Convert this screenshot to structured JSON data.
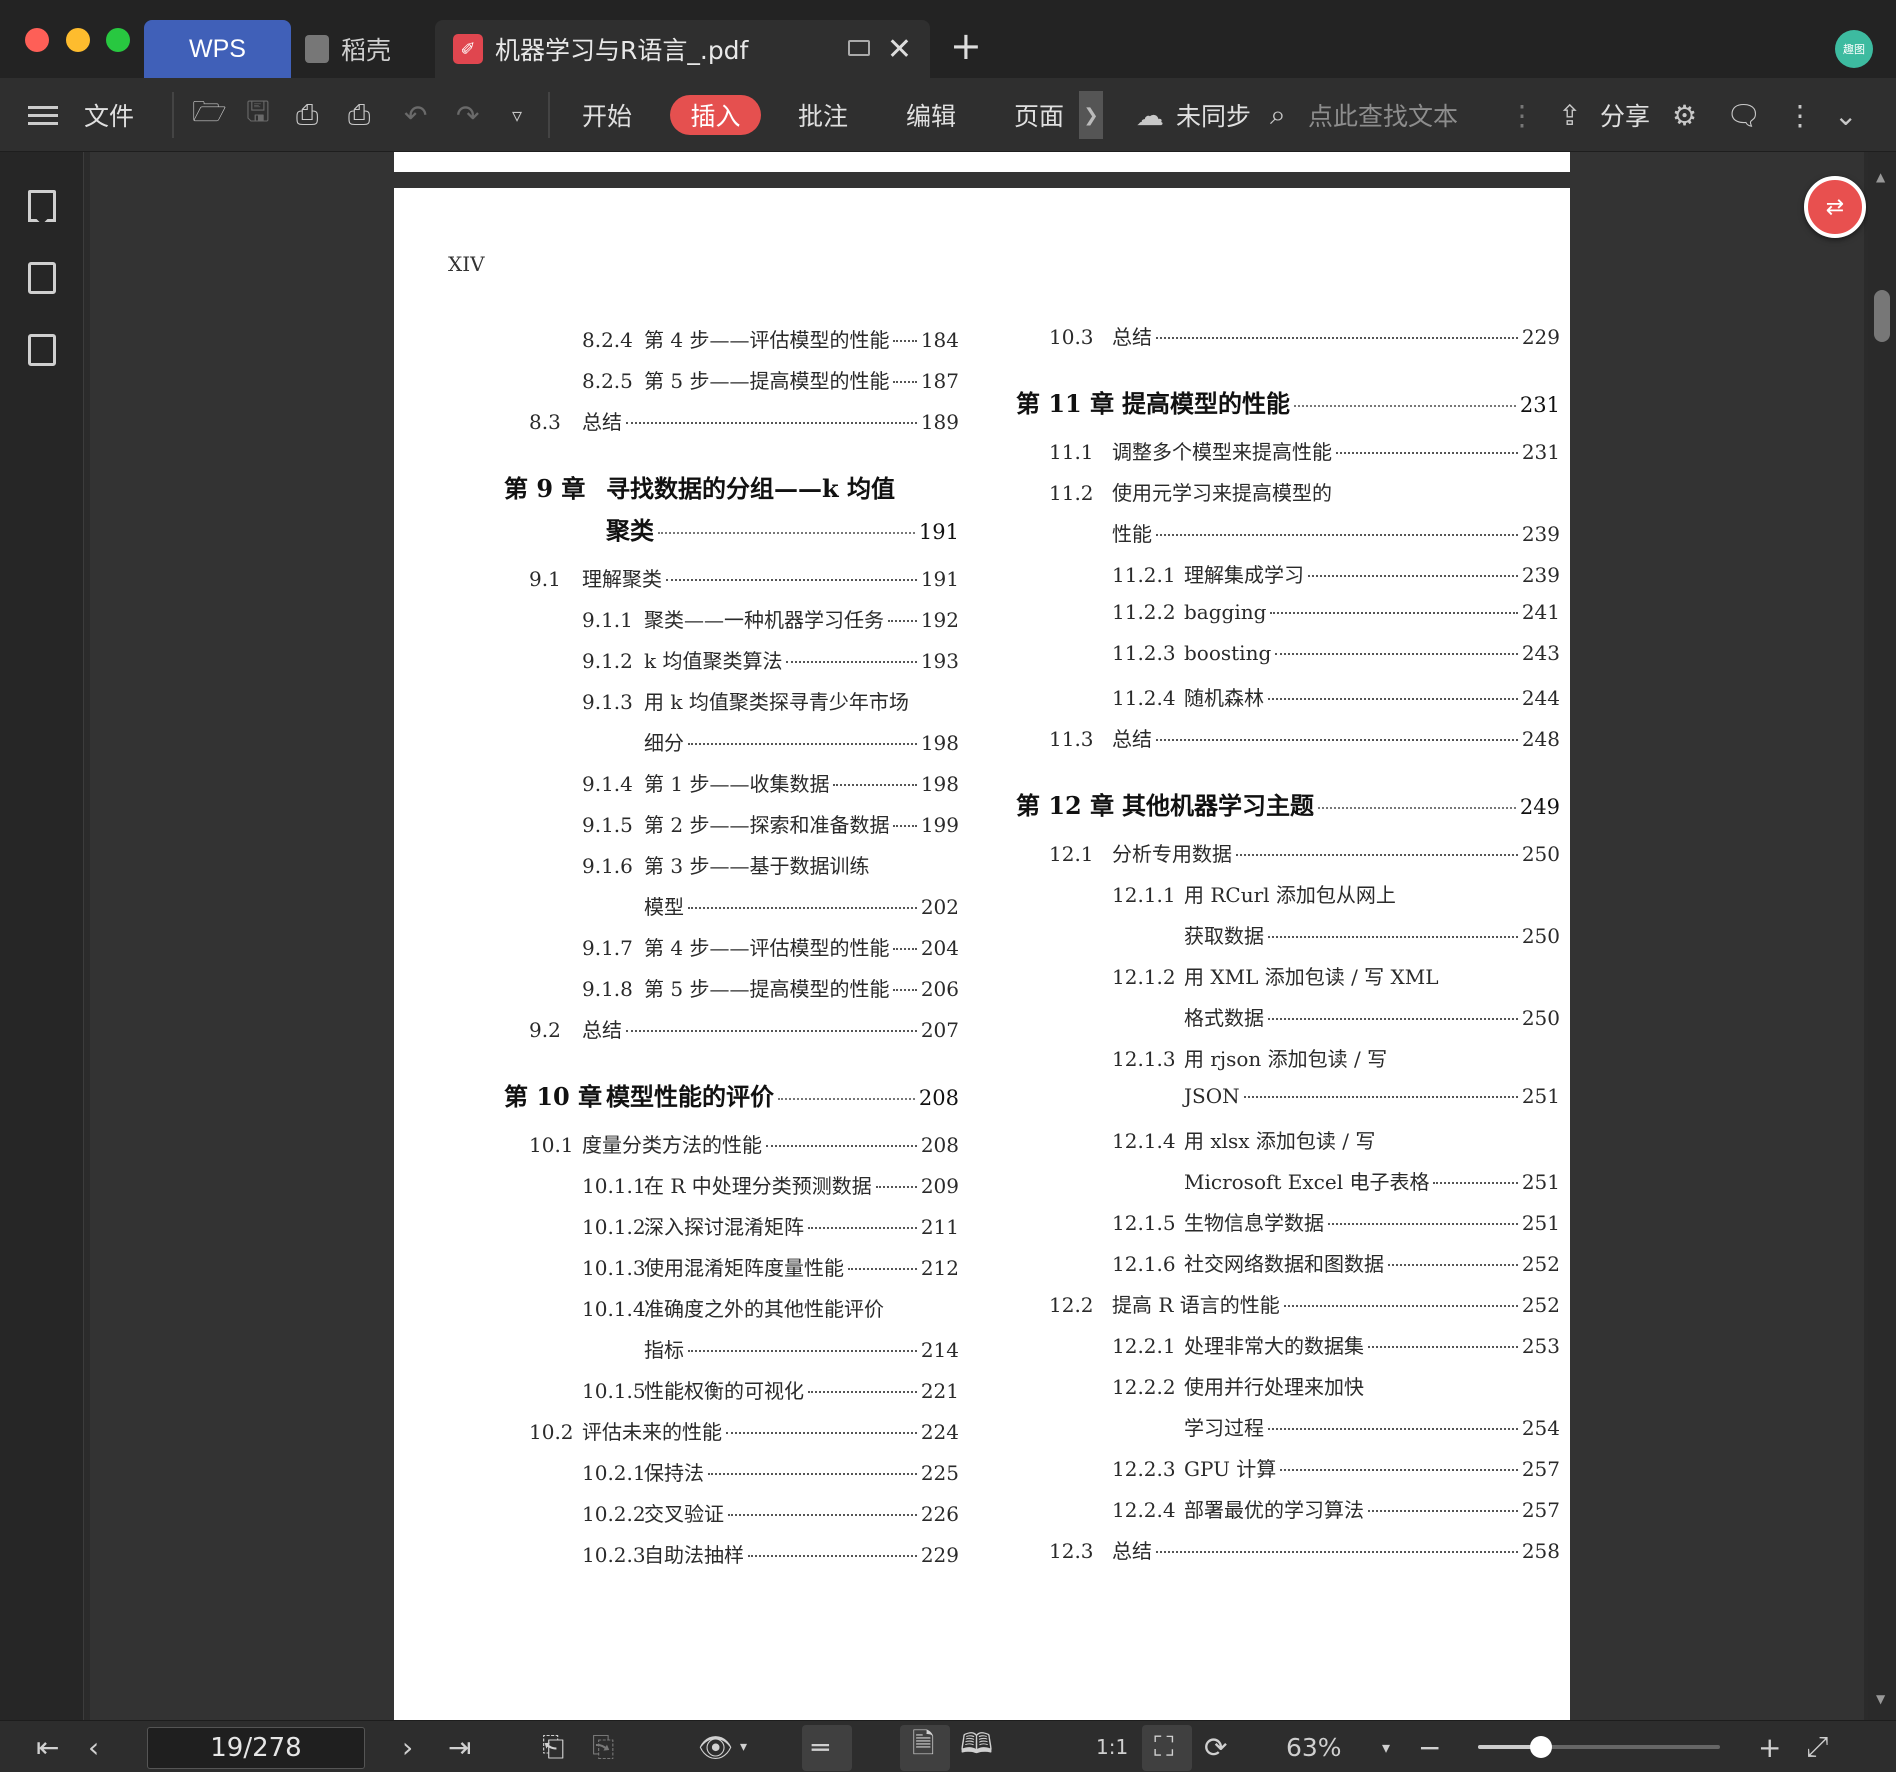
{
  "window": {
    "tabs": [
      {
        "label": "WPS"
      },
      {
        "label": "稻壳"
      },
      {
        "label": "机器学习与R语言_.pdf"
      }
    ],
    "avatar_text": "趣图"
  },
  "toolbar": {
    "file_label": "文件",
    "menu_tabs": [
      "开始",
      "插入",
      "批注",
      "编辑",
      "页面"
    ],
    "active_tab": "插入",
    "sync_label": "未同步",
    "search_placeholder": "点此查找文本",
    "share_label": "分享"
  },
  "document": {
    "page_header": "XIV",
    "left_column": [
      {
        "level": 3,
        "num": "8.2.4",
        "title": "第 4 步——评估模型的性能",
        "page": "184"
      },
      {
        "level": 3,
        "num": "8.2.5",
        "title": "第 5 步——提高模型的性能",
        "page": "187"
      },
      {
        "level": 2,
        "num": "8.3",
        "title": "总结",
        "page": "189"
      },
      {
        "level": 1,
        "num": "第 9 章",
        "title": "寻找数据的分组——k 均值",
        "page": ""
      },
      {
        "level": 1,
        "num": "",
        "title": "聚类",
        "page": "191"
      },
      {
        "level": 2,
        "num": "9.1",
        "title": "理解聚类",
        "page": "191"
      },
      {
        "level": 3,
        "num": "9.1.1",
        "title": "聚类——一种机器学习任务",
        "page": "192"
      },
      {
        "level": 3,
        "num": "9.1.2",
        "title": "k 均值聚类算法",
        "page": "193"
      },
      {
        "level": 3,
        "num": "9.1.3",
        "title": "用 k 均值聚类探寻青少年市场",
        "page": ""
      },
      {
        "level": 3,
        "num": "",
        "title": "细分",
        "page": "198"
      },
      {
        "level": 3,
        "num": "9.1.4",
        "title": "第 1 步——收集数据",
        "page": "198"
      },
      {
        "level": 3,
        "num": "9.1.5",
        "title": "第 2 步——探索和准备数据",
        "page": "199"
      },
      {
        "level": 3,
        "num": "9.1.6",
        "title": "第 3 步——基于数据训练",
        "page": ""
      },
      {
        "level": 3,
        "num": "",
        "title": "模型",
        "page": "202"
      },
      {
        "level": 3,
        "num": "9.1.7",
        "title": "第 4 步——评估模型的性能",
        "page": "204"
      },
      {
        "level": 3,
        "num": "9.1.8",
        "title": "第 5 步——提高模型的性能",
        "page": "206"
      },
      {
        "level": 2,
        "num": "9.2",
        "title": "总结",
        "page": "207"
      },
      {
        "level": 1,
        "num": "第 10 章",
        "title": "模型性能的评价",
        "page": "208"
      },
      {
        "level": 2,
        "num": "10.1",
        "title": "度量分类方法的性能",
        "page": "208"
      },
      {
        "level": 3,
        "num": "10.1.1",
        "title": "在 R 中处理分类预测数据",
        "page": "209"
      },
      {
        "level": 3,
        "num": "10.1.2",
        "title": "深入探讨混淆矩阵",
        "page": "211"
      },
      {
        "level": 3,
        "num": "10.1.3",
        "title": "使用混淆矩阵度量性能",
        "page": "212"
      },
      {
        "level": 3,
        "num": "10.1.4",
        "title": "准确度之外的其他性能评价",
        "page": ""
      },
      {
        "level": 3,
        "num": "",
        "title": "指标",
        "page": "214"
      },
      {
        "level": 3,
        "num": "10.1.5",
        "title": "性能权衡的可视化",
        "page": "221"
      },
      {
        "level": 2,
        "num": "10.2",
        "title": "评估未来的性能",
        "page": "224"
      },
      {
        "level": 3,
        "num": "10.2.1",
        "title": "保持法",
        "page": "225"
      },
      {
        "level": 3,
        "num": "10.2.2",
        "title": "交叉验证",
        "page": "226"
      },
      {
        "level": 3,
        "num": "10.2.3",
        "title": "自助法抽样",
        "page": "229"
      }
    ],
    "right_column": [
      {
        "level": 2,
        "num": "10.3",
        "title": "总结",
        "page": "229"
      },
      {
        "level": 1,
        "num": "第 11 章",
        "title": "提高模型的性能",
        "page": "231"
      },
      {
        "level": 2,
        "num": "11.1",
        "title": "调整多个模型来提高性能",
        "page": "231"
      },
      {
        "level": 2,
        "num": "11.2",
        "title": "使用元学习来提高模型的",
        "page": ""
      },
      {
        "level": 2,
        "num": "",
        "title": "性能",
        "page": "239"
      },
      {
        "level": 3,
        "num": "11.2.1",
        "title": "理解集成学习",
        "page": "239"
      },
      {
        "level": 3,
        "num": "11.2.2",
        "title": "bagging",
        "page": "241"
      },
      {
        "level": 3,
        "num": "11.2.3",
        "title": "boosting",
        "page": "243"
      },
      {
        "level": 3,
        "num": "11.2.4",
        "title": "随机森林",
        "page": "244"
      },
      {
        "level": 2,
        "num": "11.3",
        "title": "总结",
        "page": "248"
      },
      {
        "level": 1,
        "num": "第 12 章",
        "title": "其他机器学习主题",
        "page": "249"
      },
      {
        "level": 2,
        "num": "12.1",
        "title": "分析专用数据",
        "page": "250"
      },
      {
        "level": 3,
        "num": "12.1.1",
        "title": "用 RCurl 添加包从网上",
        "page": ""
      },
      {
        "level": 3,
        "num": "",
        "title": "获取数据",
        "page": "250"
      },
      {
        "level": 3,
        "num": "12.1.2",
        "title": "用 XML 添加包读 / 写 XML",
        "page": ""
      },
      {
        "level": 3,
        "num": "",
        "title": "格式数据",
        "page": "250"
      },
      {
        "level": 3,
        "num": "12.1.3",
        "title": "用 rjson 添加包读 / 写",
        "page": ""
      },
      {
        "level": 3,
        "num": "",
        "title": "JSON",
        "page": "251"
      },
      {
        "level": 3,
        "num": "12.1.4",
        "title": "用 xlsx 添加包读 / 写",
        "page": ""
      },
      {
        "level": 3,
        "num": "",
        "title": "Microsoft Excel 电子表格",
        "page": "251"
      },
      {
        "level": 3,
        "num": "12.1.5",
        "title": "生物信息学数据",
        "page": "251"
      },
      {
        "level": 3,
        "num": "12.1.6",
        "title": "社交网络数据和图数据",
        "page": "252"
      },
      {
        "level": 2,
        "num": "12.2",
        "title": "提高 R 语言的性能",
        "page": "252"
      },
      {
        "level": 3,
        "num": "12.2.1",
        "title": "处理非常大的数据集",
        "page": "253"
      },
      {
        "level": 3,
        "num": "12.2.2",
        "title": "使用并行处理来加快",
        "page": ""
      },
      {
        "level": 3,
        "num": "",
        "title": "学习过程",
        "page": "254"
      },
      {
        "level": 3,
        "num": "12.2.3",
        "title": "GPU 计算",
        "page": "257"
      },
      {
        "level": 3,
        "num": "12.2.4",
        "title": "部署最优的学习算法",
        "page": "257"
      },
      {
        "level": 2,
        "num": "12.3",
        "title": "总结",
        "page": "258"
      }
    ]
  },
  "statusbar": {
    "page_indicator": "19/278",
    "zoom_label": "63%",
    "zoom_fraction": 0.26
  },
  "colors": {
    "accent": "#e5504f",
    "wps_tab": "#4060b8",
    "chrome_bg": "#2f2f2f"
  }
}
